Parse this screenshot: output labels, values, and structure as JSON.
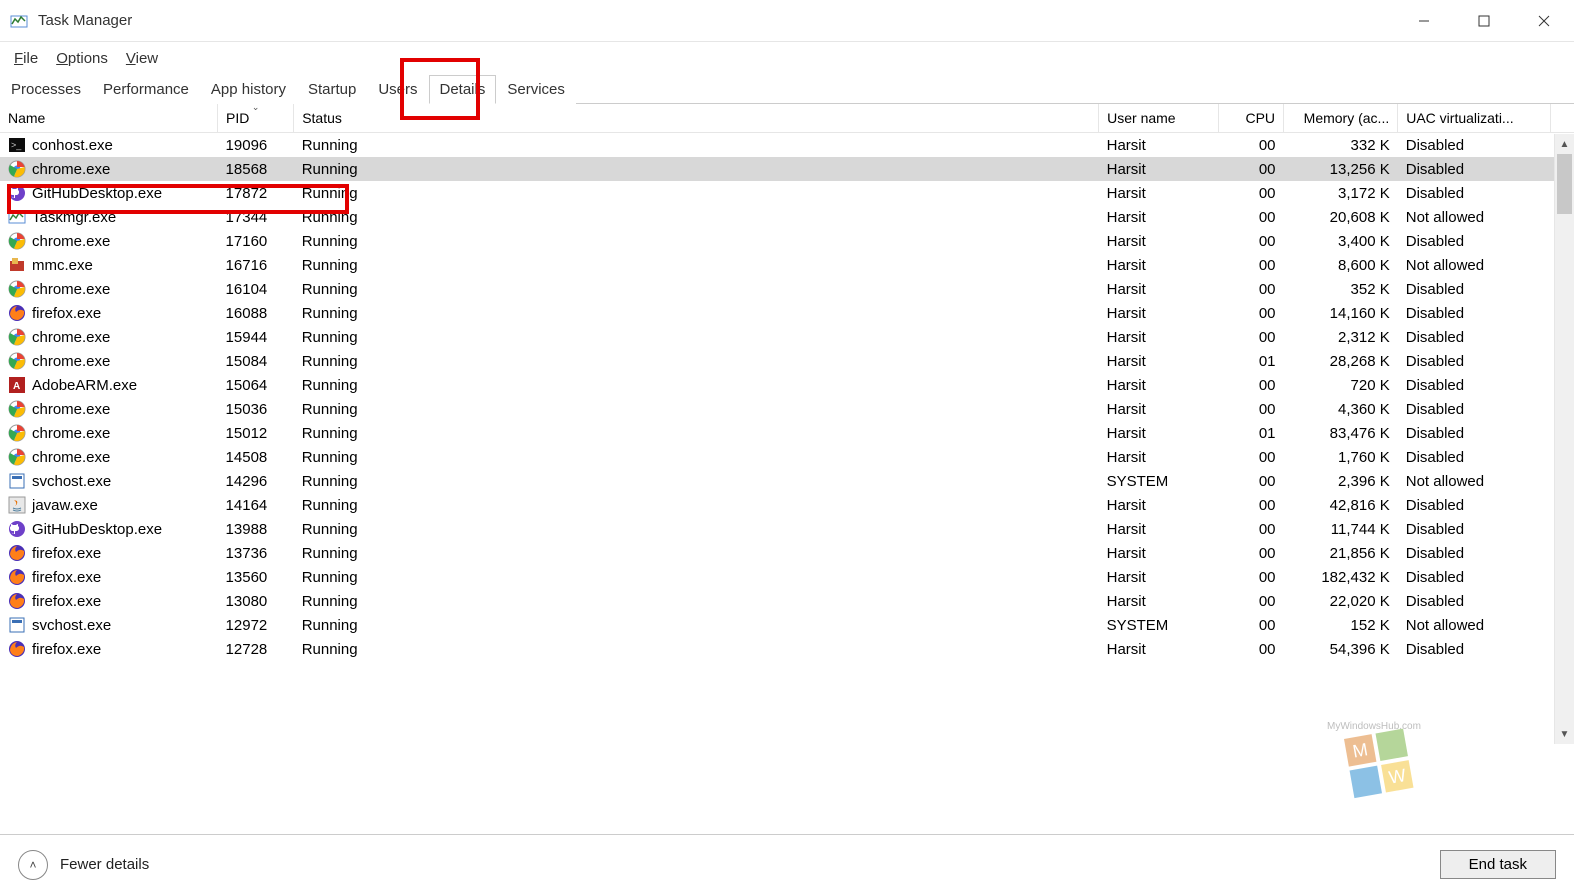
{
  "window": {
    "title": "Task Manager"
  },
  "menubar": [
    {
      "label": "File",
      "underline": "F"
    },
    {
      "label": "Options",
      "underline": "O"
    },
    {
      "label": "View",
      "underline": "V"
    }
  ],
  "tabs": [
    {
      "label": "Processes"
    },
    {
      "label": "Performance"
    },
    {
      "label": "App history"
    },
    {
      "label": "Startup"
    },
    {
      "label": "Users"
    },
    {
      "label": "Details",
      "active": true
    },
    {
      "label": "Services"
    }
  ],
  "columns": [
    {
      "key": "name",
      "label": "Name"
    },
    {
      "key": "pid",
      "label": "PID",
      "sorted": true
    },
    {
      "key": "status",
      "label": "Status"
    },
    {
      "key": "user",
      "label": "User name"
    },
    {
      "key": "cpu",
      "label": "CPU"
    },
    {
      "key": "mem",
      "label": "Memory (ac..."
    },
    {
      "key": "uac",
      "label": "UAC virtualizati..."
    }
  ],
  "processes": [
    {
      "icon": "console",
      "name": "conhost.exe",
      "pid": "19096",
      "status": "Running",
      "user": "Harsit",
      "cpu": "00",
      "mem": "332 K",
      "uac": "Disabled"
    },
    {
      "icon": "chrome",
      "name": "chrome.exe",
      "pid": "18568",
      "status": "Running",
      "user": "Harsit",
      "cpu": "00",
      "mem": "13,256 K",
      "uac": "Disabled",
      "selected": true
    },
    {
      "icon": "github",
      "name": "GitHubDesktop.exe",
      "pid": "17872",
      "status": "Running",
      "user": "Harsit",
      "cpu": "00",
      "mem": "3,172 K",
      "uac": "Disabled"
    },
    {
      "icon": "taskmgr",
      "name": "Taskmgr.exe",
      "pid": "17344",
      "status": "Running",
      "user": "Harsit",
      "cpu": "00",
      "mem": "20,608 K",
      "uac": "Not allowed"
    },
    {
      "icon": "chrome",
      "name": "chrome.exe",
      "pid": "17160",
      "status": "Running",
      "user": "Harsit",
      "cpu": "00",
      "mem": "3,400 K",
      "uac": "Disabled"
    },
    {
      "icon": "mmc",
      "name": "mmc.exe",
      "pid": "16716",
      "status": "Running",
      "user": "Harsit",
      "cpu": "00",
      "mem": "8,600 K",
      "uac": "Not allowed"
    },
    {
      "icon": "chrome",
      "name": "chrome.exe",
      "pid": "16104",
      "status": "Running",
      "user": "Harsit",
      "cpu": "00",
      "mem": "352 K",
      "uac": "Disabled"
    },
    {
      "icon": "firefox",
      "name": "firefox.exe",
      "pid": "16088",
      "status": "Running",
      "user": "Harsit",
      "cpu": "00",
      "mem": "14,160 K",
      "uac": "Disabled"
    },
    {
      "icon": "chrome",
      "name": "chrome.exe",
      "pid": "15944",
      "status": "Running",
      "user": "Harsit",
      "cpu": "00",
      "mem": "2,312 K",
      "uac": "Disabled"
    },
    {
      "icon": "chrome",
      "name": "chrome.exe",
      "pid": "15084",
      "status": "Running",
      "user": "Harsit",
      "cpu": "01",
      "mem": "28,268 K",
      "uac": "Disabled"
    },
    {
      "icon": "adobe",
      "name": "AdobeARM.exe",
      "pid": "15064",
      "status": "Running",
      "user": "Harsit",
      "cpu": "00",
      "mem": "720 K",
      "uac": "Disabled"
    },
    {
      "icon": "chrome",
      "name": "chrome.exe",
      "pid": "15036",
      "status": "Running",
      "user": "Harsit",
      "cpu": "00",
      "mem": "4,360 K",
      "uac": "Disabled"
    },
    {
      "icon": "chrome",
      "name": "chrome.exe",
      "pid": "15012",
      "status": "Running",
      "user": "Harsit",
      "cpu": "01",
      "mem": "83,476 K",
      "uac": "Disabled"
    },
    {
      "icon": "chrome",
      "name": "chrome.exe",
      "pid": "14508",
      "status": "Running",
      "user": "Harsit",
      "cpu": "00",
      "mem": "1,760 K",
      "uac": "Disabled"
    },
    {
      "icon": "service",
      "name": "svchost.exe",
      "pid": "14296",
      "status": "Running",
      "user": "SYSTEM",
      "cpu": "00",
      "mem": "2,396 K",
      "uac": "Not allowed"
    },
    {
      "icon": "java",
      "name": "javaw.exe",
      "pid": "14164",
      "status": "Running",
      "user": "Harsit",
      "cpu": "00",
      "mem": "42,816 K",
      "uac": "Disabled"
    },
    {
      "icon": "github",
      "name": "GitHubDesktop.exe",
      "pid": "13988",
      "status": "Running",
      "user": "Harsit",
      "cpu": "00",
      "mem": "11,744 K",
      "uac": "Disabled"
    },
    {
      "icon": "firefox",
      "name": "firefox.exe",
      "pid": "13736",
      "status": "Running",
      "user": "Harsit",
      "cpu": "00",
      "mem": "21,856 K",
      "uac": "Disabled"
    },
    {
      "icon": "firefox",
      "name": "firefox.exe",
      "pid": "13560",
      "status": "Running",
      "user": "Harsit",
      "cpu": "00",
      "mem": "182,432 K",
      "uac": "Disabled"
    },
    {
      "icon": "firefox",
      "name": "firefox.exe",
      "pid": "13080",
      "status": "Running",
      "user": "Harsit",
      "cpu": "00",
      "mem": "22,020 K",
      "uac": "Disabled"
    },
    {
      "icon": "service",
      "name": "svchost.exe",
      "pid": "12972",
      "status": "Running",
      "user": "SYSTEM",
      "cpu": "00",
      "mem": "152 K",
      "uac": "Not allowed"
    },
    {
      "icon": "firefox",
      "name": "firefox.exe",
      "pid": "12728",
      "status": "Running",
      "user": "Harsit",
      "cpu": "00",
      "mem": "54,396 K",
      "uac": "Disabled"
    }
  ],
  "footer": {
    "fewer_details": "Fewer details",
    "end_task": "End task"
  },
  "watermark_text": "MyWindowsHub.com"
}
